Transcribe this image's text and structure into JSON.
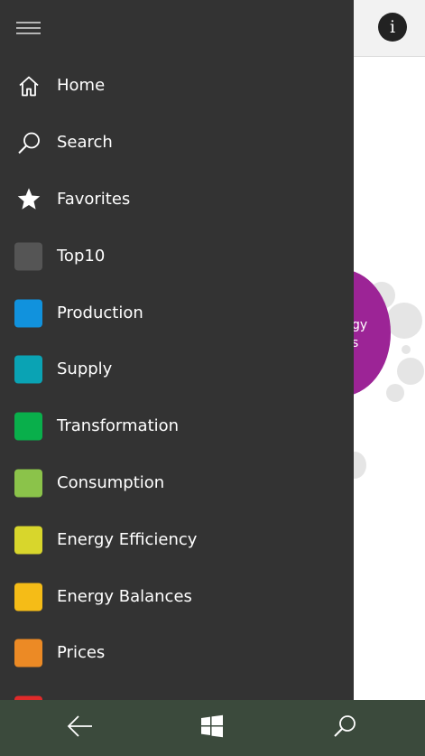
{
  "header": {
    "info_label": "i"
  },
  "background": {
    "bubble_line1": "gy",
    "bubble_line2": "s",
    "bubble_color": "#9c2496"
  },
  "menu": {
    "items": [
      {
        "label": "Home",
        "icon": "home-icon"
      },
      {
        "label": "Search",
        "icon": "search-icon"
      },
      {
        "label": "Favorites",
        "icon": "star-icon"
      },
      {
        "label": "Top10",
        "color": "#555555"
      },
      {
        "label": "Production",
        "color": "#1192dd"
      },
      {
        "label": "Supply",
        "color": "#0aa3b4"
      },
      {
        "label": "Transformation",
        "color": "#09af4b"
      },
      {
        "label": "Consumption",
        "color": "#8bc34a"
      },
      {
        "label": "Energy Efficiency",
        "color": "#d8d62c"
      },
      {
        "label": "Energy Balances",
        "color": "#f5bc17"
      },
      {
        "label": "Prices",
        "color": "#ec8a25"
      },
      {
        "label": "",
        "color": "#e02a2a"
      }
    ]
  },
  "system_bar": {
    "icons": [
      "back-arrow-icon",
      "windows-logo-icon",
      "search-icon"
    ]
  }
}
